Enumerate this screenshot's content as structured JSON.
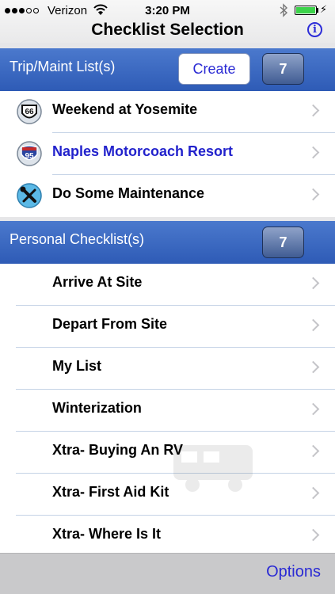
{
  "status_bar": {
    "carrier": "Verizon",
    "time": "3:20 PM",
    "signal_bars_filled": 3,
    "signal_bars_total": 5,
    "battery_level": 1.0,
    "battery_color": "#3cd34a"
  },
  "nav": {
    "title": "Checklist Selection",
    "info_label": "i"
  },
  "trip_section": {
    "title": "Trip/Maint List(s)",
    "create_label": "Create",
    "count": "7",
    "items": [
      {
        "label": "Weekend at Yosemite",
        "icon": "route-66-shield-icon"
      },
      {
        "label": "Naples Motorcoach Resort",
        "icon": "interstate-95-shield-icon",
        "color": "#2222cc"
      },
      {
        "label": "Do Some Maintenance",
        "icon": "wrench-screwdriver-icon"
      }
    ]
  },
  "personal_section": {
    "title": "Personal Checklist(s)",
    "count": "7",
    "items": [
      {
        "label": "Arrive At Site"
      },
      {
        "label": "Depart From Site"
      },
      {
        "label": "My List"
      },
      {
        "label": "Winterization"
      },
      {
        "label": "Xtra- Buying An RV"
      },
      {
        "label": "Xtra- First Aid Kit"
      },
      {
        "label": "Xtra- Where Is It"
      }
    ]
  },
  "footer": {
    "options_label": "Options"
  },
  "colors": {
    "header_blue": "#2e5bb6",
    "link_blue": "#2a2ad4"
  }
}
